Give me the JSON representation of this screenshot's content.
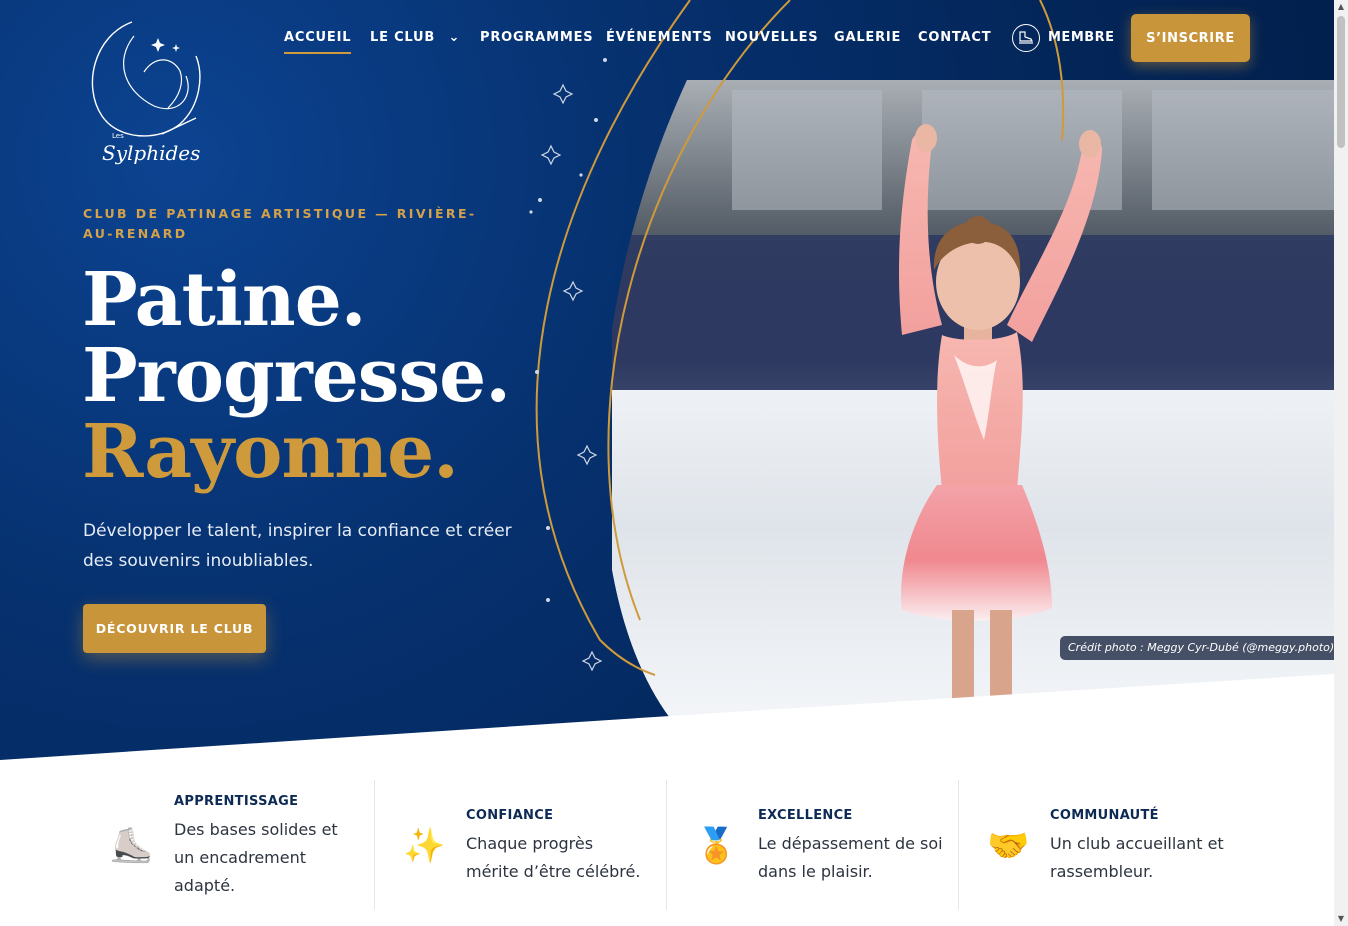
{
  "brand": {
    "logo_small": "Les",
    "logo_name": "Sylphides"
  },
  "nav": {
    "items": [
      {
        "label": "ACCUEIL",
        "active": true
      },
      {
        "label": "LE CLUB",
        "has_dropdown": true,
        "dropdown_glyph": "⌄"
      },
      {
        "label": "PROGRAMMES"
      },
      {
        "label": "ÉVÉNEMENTS"
      },
      {
        "label": "NOUVELLES"
      },
      {
        "label": "GALERIE"
      },
      {
        "label": "CONTACT"
      }
    ],
    "member_label": "MEMBRE",
    "member_icon": "skate-icon",
    "signup_label": "S’INSCRIRE"
  },
  "hero": {
    "eyebrow": "CLUB DE PATINAGE ARTISTIQUE — RIVIÈRE-AU-RENARD",
    "headline_1": "Patine.",
    "headline_2": "Progresse.",
    "headline_3": "Rayonne.",
    "tagline": "Développer le talent, inspirer la confiance et créer des souvenirs inoubliables.",
    "cta_label": "DÉCOUVRIR LE CLUB",
    "photo_credit": "Crédit photo : Meggy Cyr-Dubé (@meggy.photo)"
  },
  "values": [
    {
      "emoji": "⛸️",
      "icon": "skate-icon",
      "title": "APPRENTISSAGE",
      "desc": "Des bases solides et un encadrement adapté."
    },
    {
      "emoji": "✨",
      "icon": "sparkles-icon",
      "title": "CONFIANCE",
      "desc": "Chaque progrès mérite d’être célébré."
    },
    {
      "emoji": "🏅",
      "icon": "medal-icon",
      "title": "EXCELLENCE",
      "desc": "Le dépassement de soi dans le plaisir."
    },
    {
      "emoji": "🤝",
      "icon": "handshake-icon",
      "title": "COMMUNAUTÉ",
      "desc": "Un club accueillant et rassembleur."
    }
  ],
  "colors": {
    "navy": "#032558",
    "gold": "#c9953a",
    "gold_text": "#cf9a3b",
    "value_title": "#0d2a55"
  }
}
